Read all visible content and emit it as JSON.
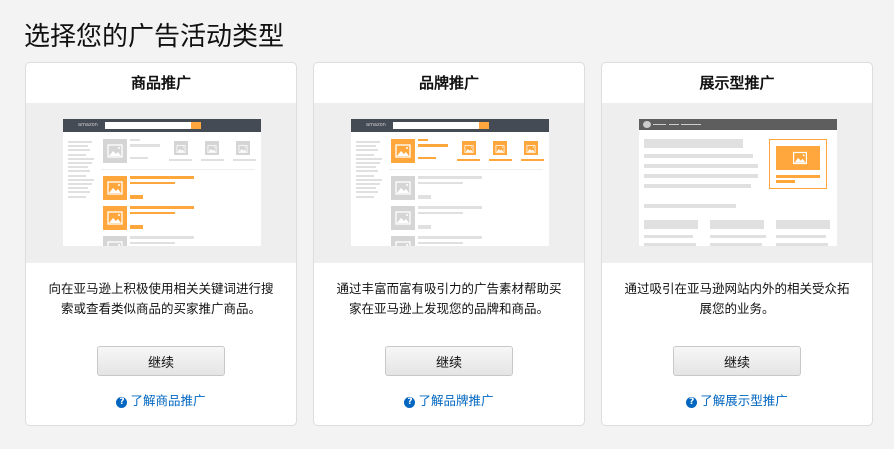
{
  "page_title": "选择您的广告活动类型",
  "cards": [
    {
      "title": "商品推广",
      "desc": "向在亚马逊上积极使用相关关键词进行搜索或查看类似商品的买家推广商品。",
      "button": "继续",
      "link": "了解商品推广",
      "logo": "amazon"
    },
    {
      "title": "品牌推广",
      "desc": "通过丰富而富有吸引力的广告素材帮助买家在亚马逊上发现您的品牌和商品。",
      "button": "继续",
      "link": "了解品牌推广",
      "logo": "amazon"
    },
    {
      "title": "展示型推广",
      "desc": "通过吸引在亚马逊网站内外的相关受众拓展您的业务。",
      "button": "继续",
      "link": "了解展示型推广"
    }
  ],
  "colors": {
    "accent": "#ffa73c",
    "link": "#0066c0",
    "header_dark": "#454b55"
  }
}
